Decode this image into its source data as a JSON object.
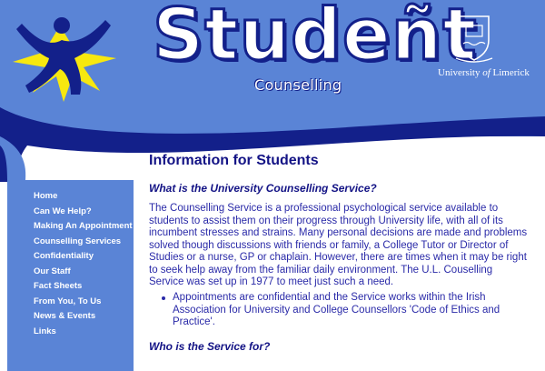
{
  "header": {
    "wordmark": "Studeñt",
    "subtitle": "Counselling",
    "university_prefix": "University ",
    "university_of": "of",
    "university_suffix": " Limerick"
  },
  "sidebar": {
    "items": [
      {
        "label": "Home"
      },
      {
        "label": "Can We Help?"
      },
      {
        "label": "Making An Appointment"
      },
      {
        "label": "Counselling Services"
      },
      {
        "label": "Confidentiality"
      },
      {
        "label": "Our Staff"
      },
      {
        "label": "Fact Sheets"
      },
      {
        "label": "From You, To Us"
      },
      {
        "label": "News & Events"
      },
      {
        "label": "Links"
      }
    ]
  },
  "main": {
    "title": "Information for Students",
    "question1": "What is the University Counselling Service?",
    "paragraph": "The Counselling Service is a professional psychological service available to students to assist them on their progress through University life, with all of its incumbent stresses and strains. Many personal decisions are made and problems solved though discussions with friends or family, a College Tutor or Director of Studies or a nurse, GP or chaplain. However, there are times when it may be right to seek help away from the familiar daily environment. The U.L. Couselling Service was set up in 1977 to meet just such a need.",
    "bullets": [
      "Appointments are confidential and the Service works within the Irish Association for University and College Counsellors 'Code of Ethics and Practice'."
    ],
    "question2": "Who is the Service for?"
  },
  "colors": {
    "header_blue": "#5a84d6",
    "dark_navy": "#13208a",
    "text_blue": "#2a2aa8",
    "logo_yellow": "#f7e80f"
  },
  "icons": {
    "logo": "student-figure-logo",
    "crest": "university-crest-icon"
  }
}
